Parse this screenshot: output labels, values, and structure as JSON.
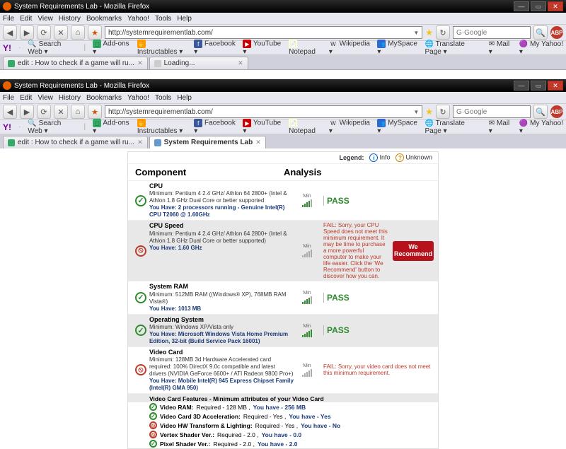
{
  "win1": {
    "title": "System Requirements Lab - Mozilla Firefox",
    "url": "http://systemrequirementlab.com/",
    "search_placeholder": "Google",
    "tab1": "edit : How to check if a game will ru...",
    "tab2": "Loading..."
  },
  "win2": {
    "title": "System Requirements Lab - Mozilla Firefox",
    "url": "http://systemrequirementlab.com/",
    "search_placeholder": "Google",
    "tab1": "edit : How to check if a game will ru...",
    "tab2": "System Requirements Lab"
  },
  "menu": [
    "File",
    "Edit",
    "View",
    "History",
    "Bookmarks",
    "Yahoo!",
    "Tools",
    "Help"
  ],
  "bookmarks": {
    "y": "Y!",
    "items": [
      "Search Web",
      "Add-ons",
      "Instructables",
      "Facebook",
      "YouTube",
      "Notepad",
      "Wikipedia",
      "MySpace",
      "Translate Page",
      "Mail",
      "My Yahoo!"
    ]
  },
  "legend": {
    "label": "Legend:",
    "info": "Info",
    "unknown": "Unknown"
  },
  "headers": {
    "component": "Component",
    "analysis": "Analysis"
  },
  "min_label": "Min",
  "pass": "PASS",
  "cpu": {
    "name": "CPU",
    "min": "Minimum: Pentium 4 2.4 GHz/ Athlon 64 2800+ (Intel & Athlon 1.8 GHz Dual Core or better supported",
    "have": "You Have: 2 processors running - Genuine Intel(R) CPU T2060 @ 1.60GHz"
  },
  "cpuspeed": {
    "name": "CPU Speed",
    "min": "Minimum: Pentium 4 2.4 GHz/ Athlon 64 2800+ (Intel & Athlon 1.8 GHz Dual Core or better supported)",
    "have": "You Have: 1.60 GHz",
    "fail": "FAIL: Sorry, your CPU Speed does not meet this minimum requirement. It may be time to purchase a more powerful computer to make your life easier. Click the 'We Recommend' button to discover how you can."
  },
  "ram": {
    "name": "System RAM",
    "min": "Minimum: 512MB RAM ((Windows® XP), 768MB RAM Vista®)",
    "have": "You Have: 1013 MB"
  },
  "os": {
    "name": "Operating System",
    "min": "Minimum: Windows XP/Vista only",
    "have": "You Have: Microsoft Windows Vista Home Premium Edition, 32-bit (Build Service Pack 16001)"
  },
  "video": {
    "name": "Video Card",
    "min": "Minimum: 128MB 3d Hardware Accelerated card required: 100% DirectX 9.0c compatible and latest drivers (NVIDIA GeForce 6600+ / ATI Radeon 9800 Pro+)",
    "have": "You Have: Mobile Intel(R) 945 Express Chipset Family (Intel(R) GMA 950)",
    "fail": "FAIL: Sorry, your video card does not meet this minimum requirement."
  },
  "features": {
    "title": "Video Card Features - Minimum attributes of your Video Card",
    "vram": {
      "label": "Video RAM:",
      "req": "Required - 128 MB ,",
      "have": "You have - 256 MB"
    },
    "accel": {
      "label": "Video Card 3D Acceleration:",
      "req": "Required - Yes ,",
      "have": "You have - Yes"
    },
    "hwtl": {
      "label": "Video HW Transform & Lighting:",
      "req": "Required - Yes ,",
      "have": "You have - No"
    },
    "vshader": {
      "label": "Vertex Shader Ver.:",
      "req": "Required - 2.0 ,",
      "have": "You have - 0.0"
    },
    "pshader": {
      "label": "Pixel Shader Ver.:",
      "req": "Required - 2.0 ,",
      "have": "You have - 2.0"
    }
  },
  "rec": "We Recommend"
}
